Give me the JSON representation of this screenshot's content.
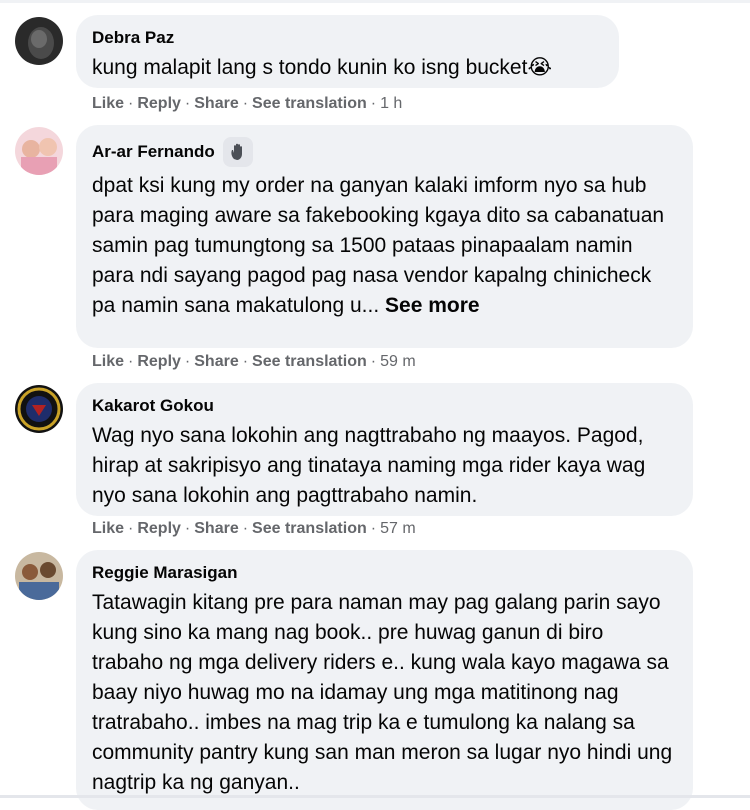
{
  "comments": [
    {
      "author": "Debra Paz",
      "text": "kung malapit lang s tondo kunin ko isng bucket",
      "emoji": "😭",
      "actions": {
        "like": "Like",
        "reply": "Reply",
        "share": "Share",
        "translate": "See translation",
        "time": "1 h"
      }
    },
    {
      "author": "Ar-ar Fernando",
      "text": "dpat ksi kung my order na ganyan kalaki imform nyo sa hub para maging aware sa fakebooking kgaya dito sa cabanatuan samin pag tumungtong sa 1500 pataas pinapaalam namin para ndi sayang pagod pag nasa vendor kapalng chinicheck pa namin sana makatulong u...",
      "see_more": "See more",
      "actions": {
        "like": "Like",
        "reply": "Reply",
        "share": "Share",
        "translate": "See translation",
        "time": "59 m"
      }
    },
    {
      "author": "Kakarot Gokou",
      "text": "Wag nyo sana lokohin ang nagttrabaho ng maayos. Pagod, hirap at sakripisyo ang tinataya naming mga rider kaya wag nyo sana lokohin ang pagttrabaho namin.",
      "actions": {
        "like": "Like",
        "reply": "Reply",
        "share": "Share",
        "translate": "See translation",
        "time": "57 m"
      }
    },
    {
      "author": "Reggie Marasigan",
      "text": "Tatawagin kitang pre para naman may pag galang parin sayo kung sino ka mang nag book.. pre huwag ganun di biro trabaho ng mga delivery riders e.. kung wala kayo magawa sa baay niyo huwag mo na idamay ung mga matitinong nag tratrabaho.. imbes na mag trip ka e tumulong ka nalang sa community pantry kung san man meron sa lugar nyo hindi ung nagtrip ka ng ganyan.."
    }
  ]
}
